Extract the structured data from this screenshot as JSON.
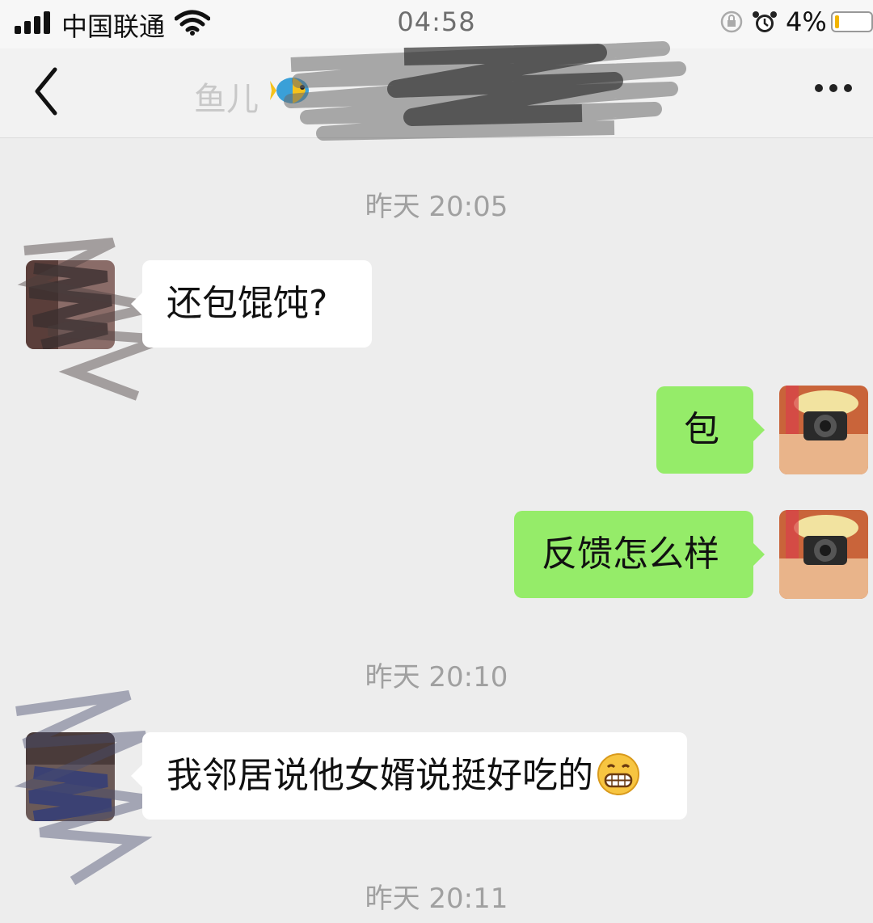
{
  "status_bar": {
    "carrier": "中国联通",
    "time": "04:58",
    "battery_percent": "4%",
    "battery_level": 0.04
  },
  "nav": {
    "title": "鱼儿",
    "title_icon": "tropical-fish-emoji"
  },
  "messages": [
    {
      "type": "time",
      "text": "昨天 20:05"
    },
    {
      "type": "message",
      "side": "left",
      "text": "还包馄饨?"
    },
    {
      "type": "message",
      "side": "right",
      "text": "包"
    },
    {
      "type": "message",
      "side": "right",
      "text": "反馈怎么样"
    },
    {
      "type": "time",
      "text": "昨天 20:10"
    },
    {
      "type": "message",
      "side": "left",
      "text": "我邻居说他女婿说挺好吃的",
      "emoji": "grinning-face"
    },
    {
      "type": "time",
      "text": "昨天 20:11"
    }
  ],
  "colors": {
    "background": "#ededed",
    "incoming_bubble": "#ffffff",
    "outgoing_bubble": "#95ec69",
    "timestamp_text": "#a0a0a0"
  }
}
